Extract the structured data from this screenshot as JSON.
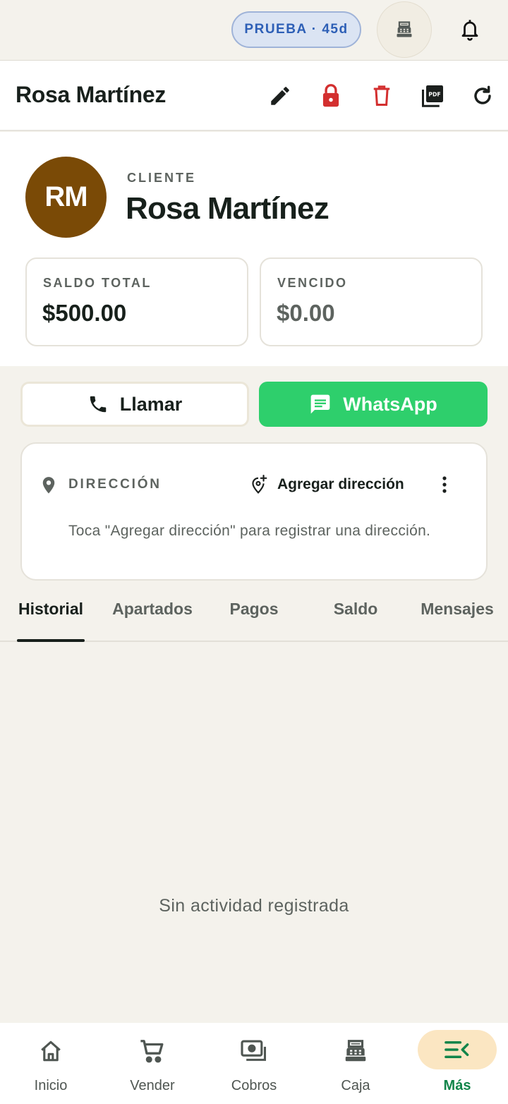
{
  "topbar": {
    "trial_badge": "PRUEBA · 45d",
    "register_icon": "cash-register-icon",
    "notifications_icon": "bell-icon"
  },
  "appbar": {
    "title": "Rosa Martínez",
    "actions": [
      "edit-icon",
      "lock-icon",
      "trash-icon",
      "pdf-icon",
      "refresh-icon"
    ],
    "colors": {
      "lock": "#d32f2f",
      "trash": "#d32f2f"
    }
  },
  "profile": {
    "initials": "RM",
    "avatar_color": "#7a4a06",
    "role": "CLIENTE",
    "name": "Rosa Martínez",
    "balance_label": "SALDO TOTAL",
    "balance_value": "$500.00",
    "overdue_label": "VENCIDO",
    "overdue_value": "$0.00"
  },
  "actions": {
    "call_label": "Llamar",
    "whatsapp_label": "WhatsApp",
    "whatsapp_color": "#2ecf6c"
  },
  "address": {
    "label": "DIRECCIÓN",
    "add_label": "Agregar dirección",
    "hint": "Toca \"Agregar dirección\" para registrar una dirección."
  },
  "tabs": [
    {
      "label": "Historial",
      "active": true
    },
    {
      "label": "Apartados",
      "active": false
    },
    {
      "label": "Pagos",
      "active": false
    },
    {
      "label": "Saldo",
      "active": false
    },
    {
      "label": "Mensajes",
      "active": false
    }
  ],
  "empty_state": "Sin actividad registrada",
  "bottom_nav": [
    {
      "label": "Inicio",
      "icon": "home-icon",
      "active": false
    },
    {
      "label": "Vender",
      "icon": "cart-icon",
      "active": false
    },
    {
      "label": "Cobros",
      "icon": "payments-icon",
      "active": false
    },
    {
      "label": "Caja",
      "icon": "cash-register-icon",
      "active": false
    },
    {
      "label": "Más",
      "icon": "menu-open-icon",
      "active": true
    }
  ],
  "accent_color": "#12854a"
}
